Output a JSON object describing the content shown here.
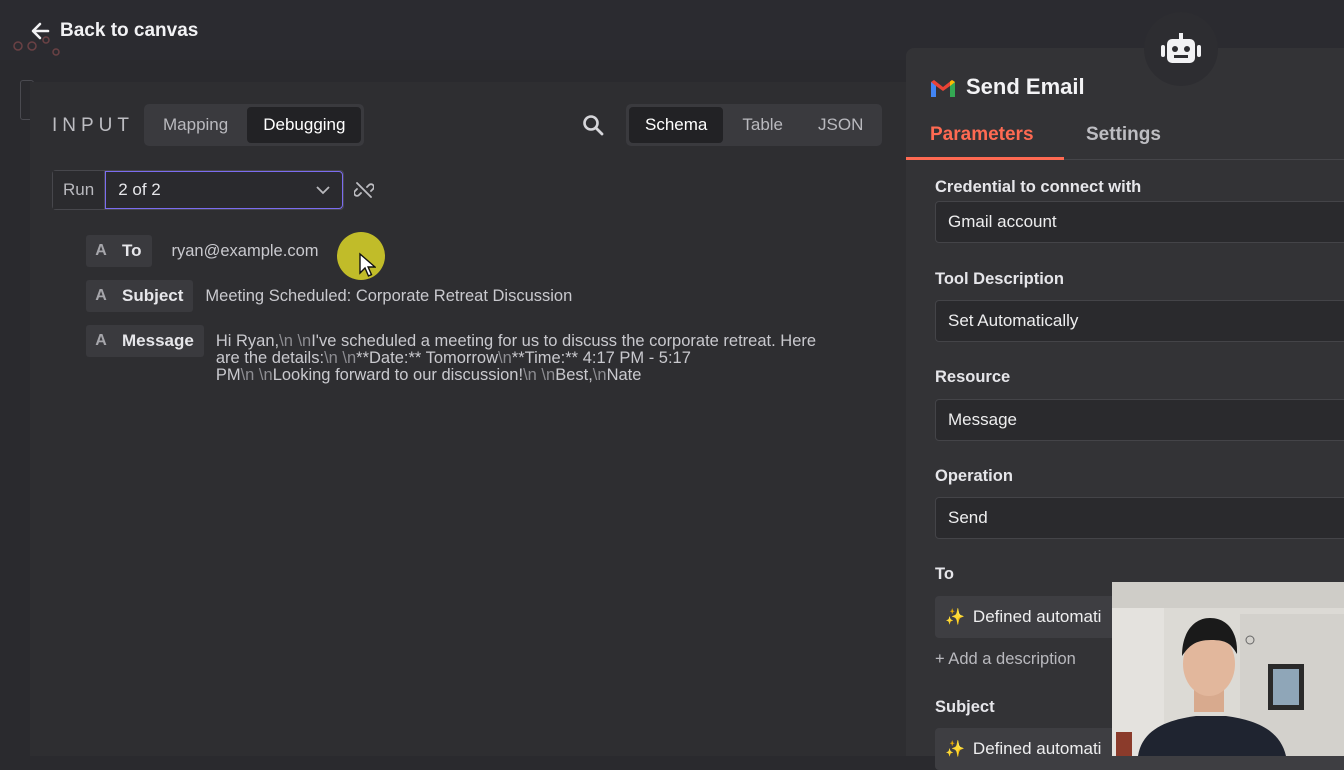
{
  "nav": {
    "back_label": "Back to canvas"
  },
  "input": {
    "label": "INPUT",
    "mode_tabs": [
      {
        "label": "Mapping",
        "active": false
      },
      {
        "label": "Debugging",
        "active": true
      }
    ],
    "view_tabs": [
      {
        "label": "Schema",
        "active": true
      },
      {
        "label": "Table",
        "active": false
      },
      {
        "label": "JSON",
        "active": false
      }
    ],
    "run_label": "Run",
    "run_value": "2 of 2",
    "fields": [
      {
        "type": "A",
        "key": "To",
        "value": "ryan@example.com"
      },
      {
        "type": "A",
        "key": "Subject",
        "value": "Meeting Scheduled: Corporate Retreat Discussion"
      },
      {
        "type": "A",
        "key": "Message",
        "value_line1": "Hi Ryan,",
        "esc1": "\\n \\n",
        "value_line1b": "I've scheduled a meeting for us to discuss the corporate retreat. Here",
        "value_line2a": "are the details:",
        "esc2": "\\n \\n",
        "value_line2b": "**Date:** Tomorrow",
        "esc3": "\\n",
        "value_line2c": "**Time:** 4:17 PM - 5:17",
        "value_line3a": "PM",
        "esc4": "\\n \\n",
        "value_line3b": "Looking forward to our discussion!",
        "esc5": "\\n \\n",
        "value_line3c": "Best,",
        "esc6": "\\n",
        "value_line3d": "Nate"
      }
    ]
  },
  "node": {
    "title": "Send Email",
    "tabs": [
      {
        "label": "Parameters",
        "active": true
      },
      {
        "label": "Settings",
        "active": false
      }
    ],
    "params": {
      "credential_label": "Credential to connect with",
      "credential_value": "Gmail account",
      "tool_desc_label": "Tool Description",
      "tool_desc_value": "Set Automatically",
      "resource_label": "Resource",
      "resource_value": "Message",
      "operation_label": "Operation",
      "operation_value": "Send",
      "to_label": "To",
      "to_value": "Defined automati",
      "add_description": "+ Add a description",
      "subject_label": "Subject",
      "subject_value": "Defined automati"
    }
  },
  "colors": {
    "accent": "#ff6a52",
    "select_border": "#7b6cf0",
    "cursor_highlight": "#dad528"
  }
}
